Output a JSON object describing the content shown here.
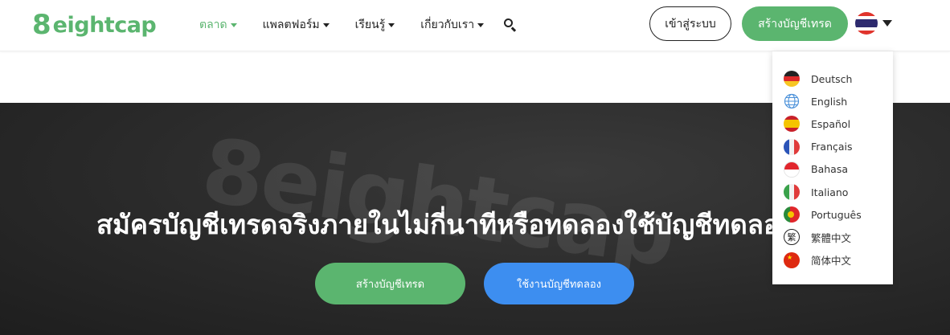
{
  "header": {
    "logo_mark": "8",
    "logo_text": "eightcap",
    "nav": [
      {
        "label": "ตลาด",
        "active": true
      },
      {
        "label": "แพลตฟอร์ม",
        "active": false
      },
      {
        "label": "เรียนรู้",
        "active": false
      },
      {
        "label": "เกี่ยวกับเรา",
        "active": false
      }
    ],
    "search_icon": "search-icon",
    "login_label": "เข้าสู่ระบบ",
    "create_account_label": "สร้างบัญชีเทรด",
    "current_language_flag": "thailand-flag-icon"
  },
  "language_menu": {
    "items": [
      {
        "label": "Deutsch",
        "icon": "germany-flag-icon"
      },
      {
        "label": "English",
        "icon": "globe-icon"
      },
      {
        "label": "Español",
        "icon": "spain-flag-icon"
      },
      {
        "label": "Français",
        "icon": "france-flag-icon"
      },
      {
        "label": "Bahasa",
        "icon": "indonesia-flag-icon"
      },
      {
        "label": "Italiano",
        "icon": "italy-flag-icon"
      },
      {
        "label": "Português",
        "icon": "portugal-flag-icon"
      },
      {
        "label": "繁體中文",
        "icon": "traditional-chinese-icon"
      },
      {
        "label": "简体中文",
        "icon": "china-flag-icon"
      }
    ]
  },
  "hero": {
    "watermark": "8eightcap",
    "title": "สมัครบัญชีเทรดจริงภายในไม่กี่นาทีหรือทดลองใช้บัญชีทดลอง",
    "primary_button": "สร้างบัญชีเทรด",
    "secondary_button": "ใช้งานบัญชีทดลอง"
  },
  "colors": {
    "brand_green": "#5bb56f",
    "demo_blue": "#3d8ef0",
    "hero_dark": "#2b2b2b"
  }
}
